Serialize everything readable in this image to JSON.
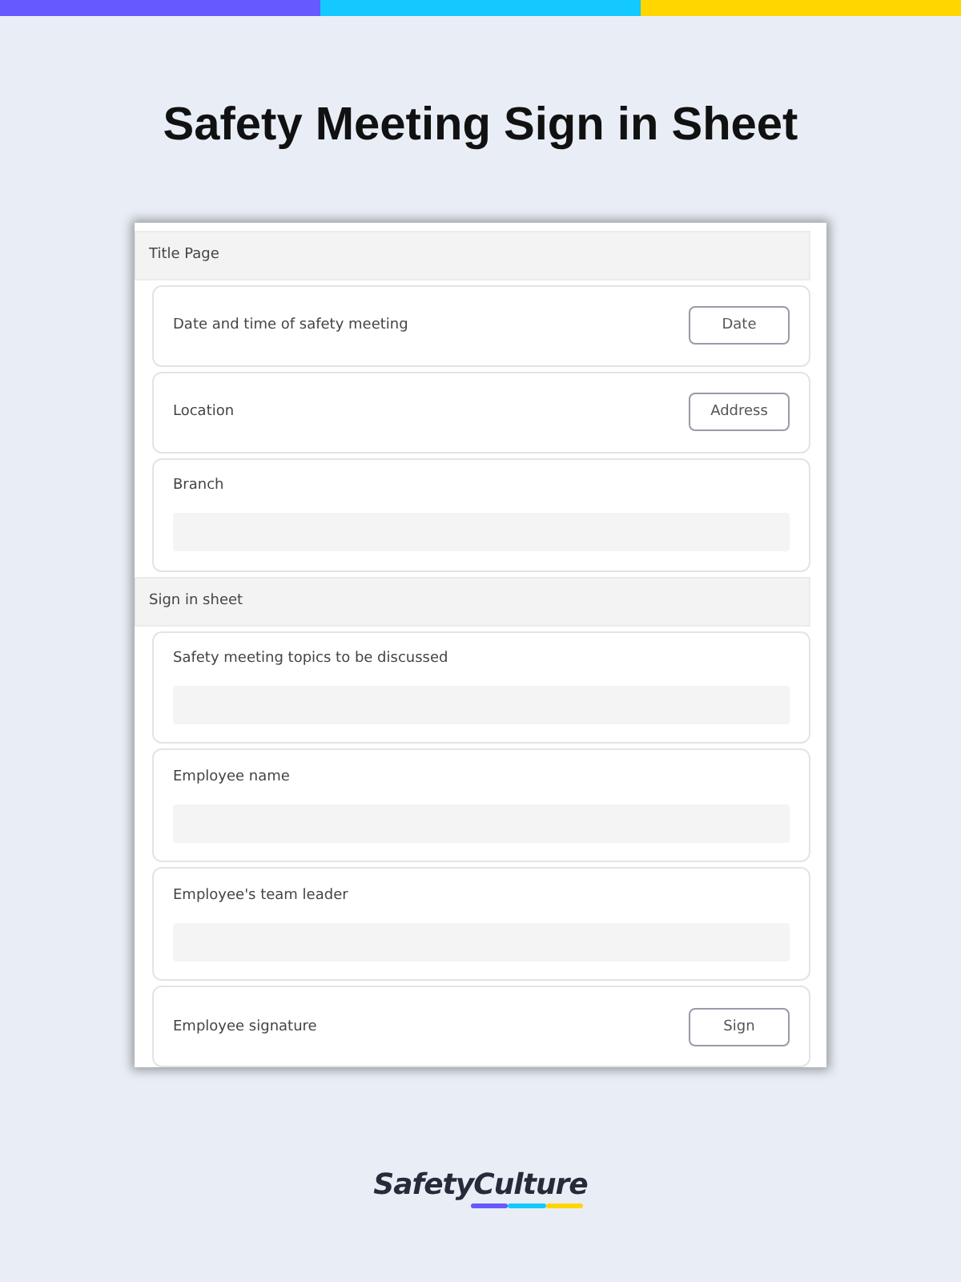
{
  "heading": "Safety Meeting Sign in Sheet",
  "sections": [
    {
      "title": "Title Page",
      "items": [
        {
          "kind": "button",
          "label": "Date and time of safety meeting",
          "button": "Date"
        },
        {
          "kind": "button",
          "label": "Location",
          "button": "Address"
        },
        {
          "kind": "text",
          "label": "Branch"
        }
      ]
    },
    {
      "title": "Sign in sheet",
      "items": [
        {
          "kind": "text",
          "label": "Safety meeting topics to be discussed"
        },
        {
          "kind": "text",
          "label": "Employee name"
        },
        {
          "kind": "text",
          "label": "Employee's team leader"
        },
        {
          "kind": "button",
          "label": "Employee signature",
          "button": "Sign"
        }
      ]
    }
  ],
  "brand": "SafetyCulture"
}
